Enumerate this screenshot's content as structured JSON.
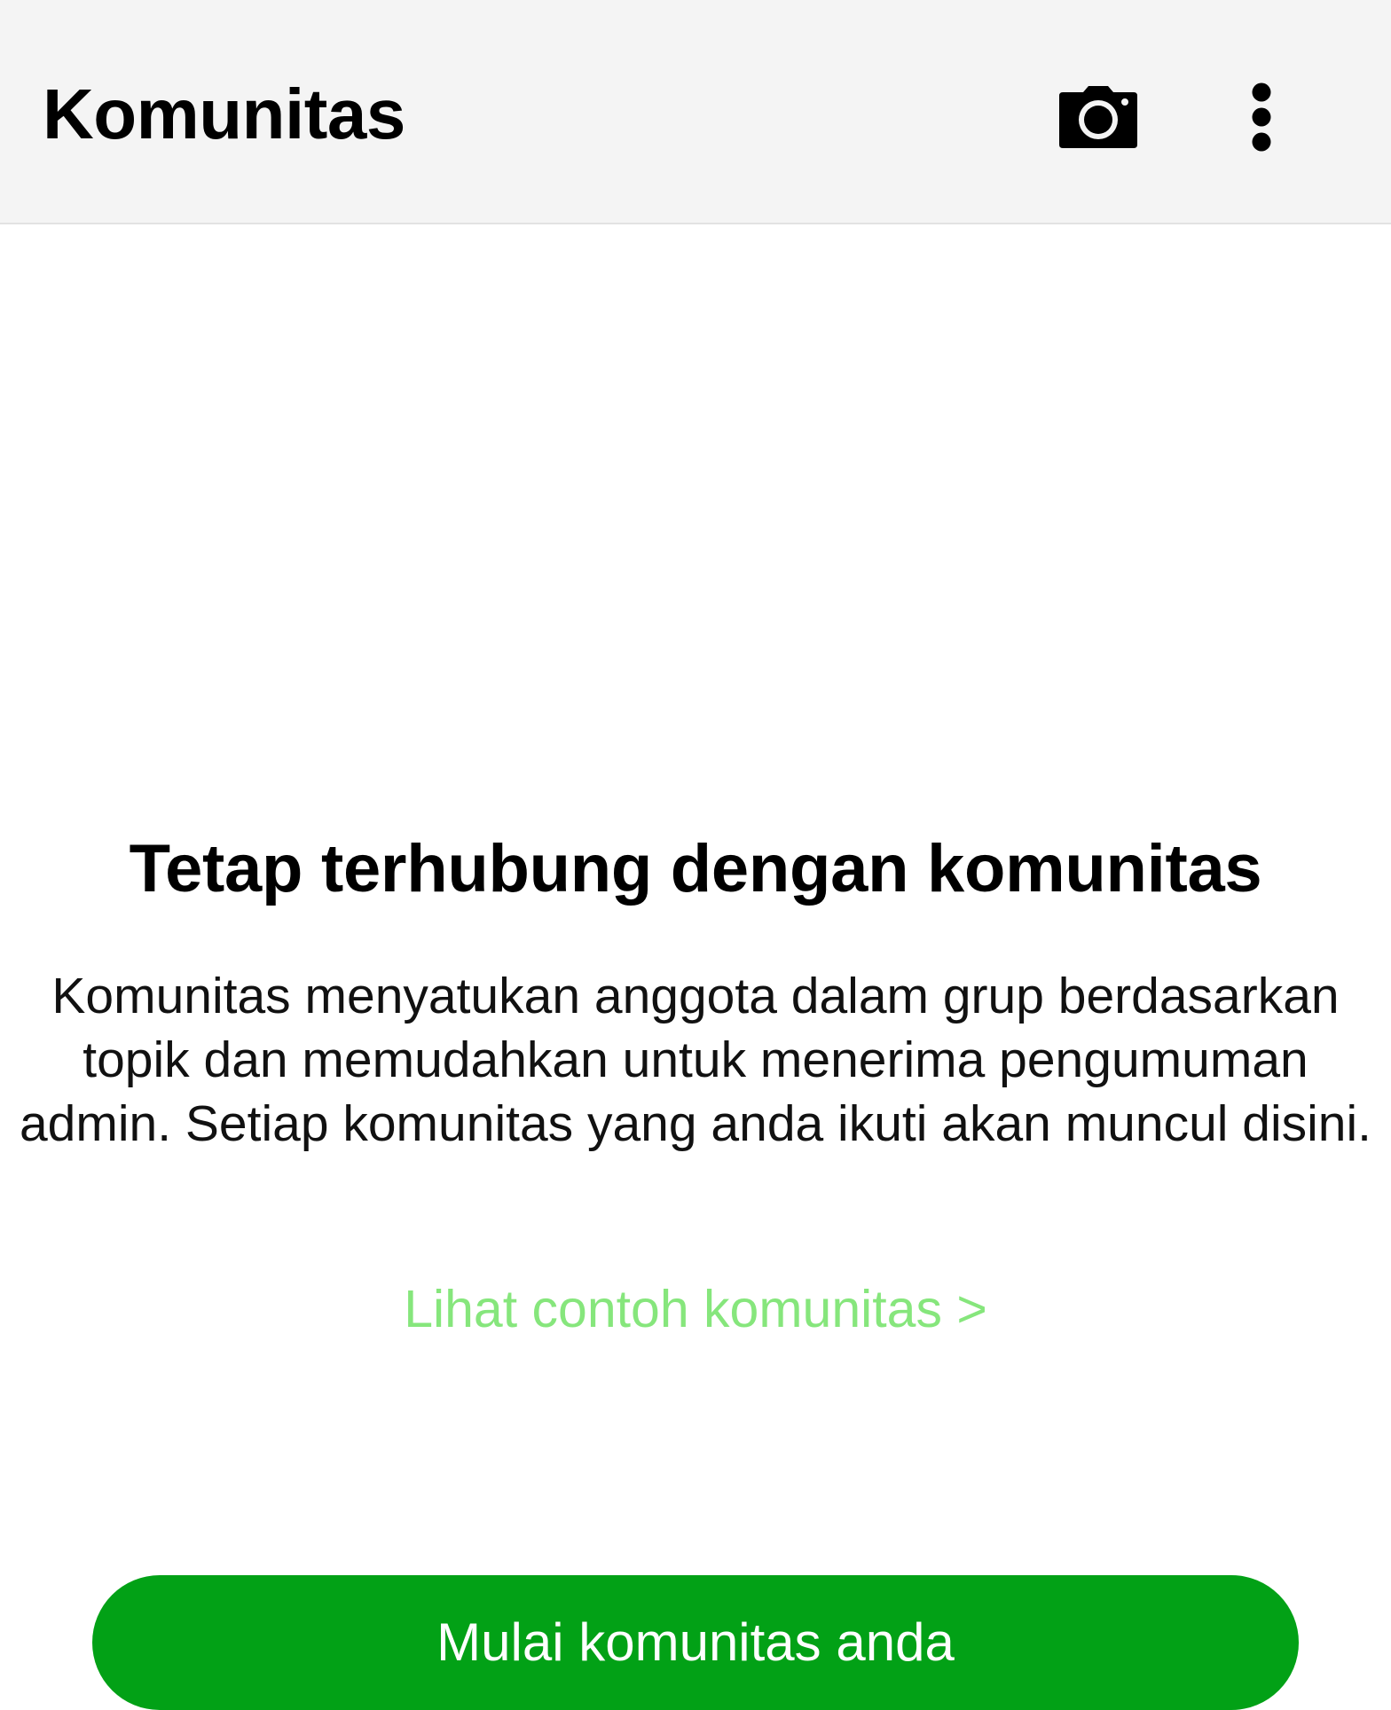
{
  "header": {
    "title": "Komunitas",
    "camera_icon": "camera-icon",
    "more_icon": "more-vertical-icon"
  },
  "main": {
    "headline": "Tetap terhubung dengan komunitas",
    "description": "Komunitas menyatukan anggota dalam grup berdasarkan topik dan memudahkan untuk menerima pengumuman admin. Setiap komunitas yang anda ikuti akan muncul disini.",
    "example_link": "Lihat contoh komunitas >",
    "start_button": "Mulai komunitas anda"
  },
  "colors": {
    "app_bar_background": "#f4f4f4",
    "link": "#86e67c",
    "primary_button": "#02a116"
  }
}
